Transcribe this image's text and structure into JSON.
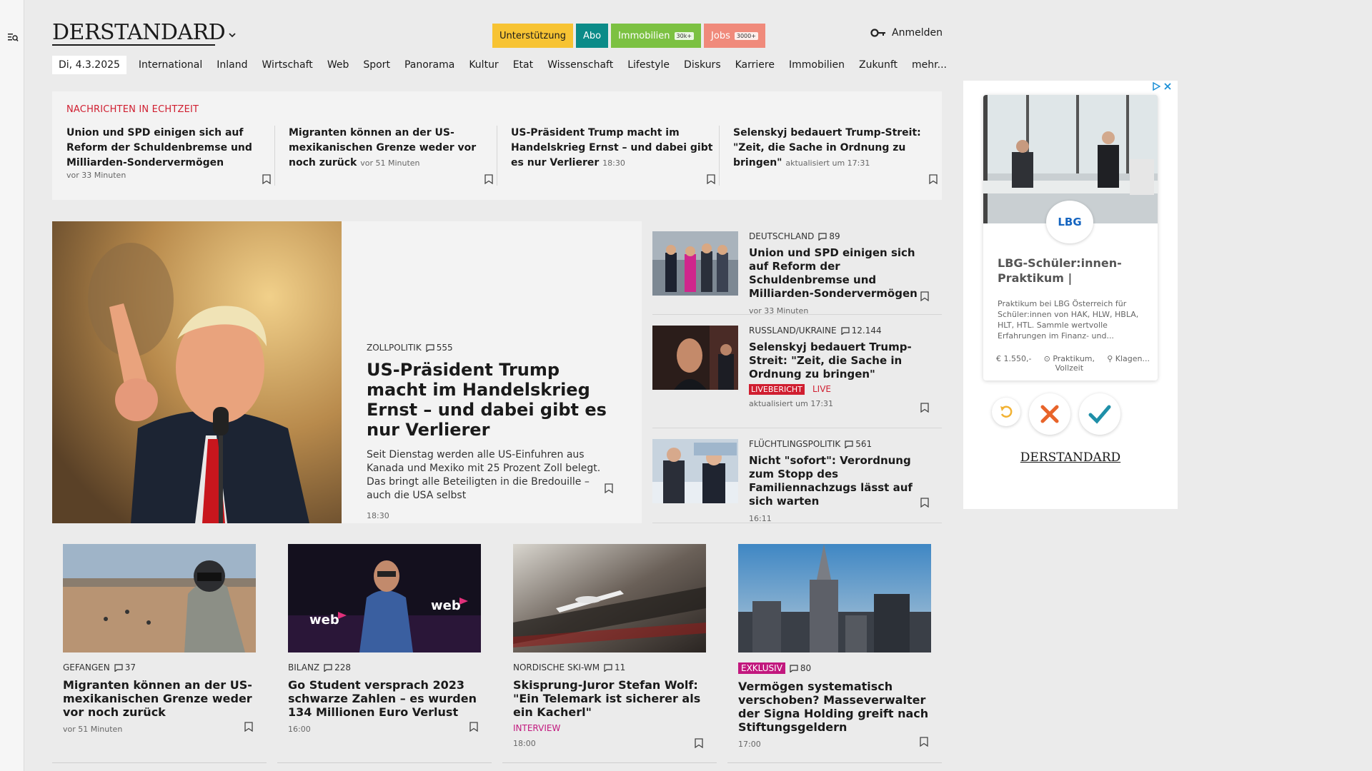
{
  "header": {
    "logo": "DERSTANDARD",
    "pills": [
      {
        "label": "Unterstützung",
        "badge": ""
      },
      {
        "label": "Abo",
        "badge": ""
      },
      {
        "label": "Immobilien",
        "badge": "30k+"
      },
      {
        "label": "Jobs",
        "badge": "3000+"
      }
    ],
    "login": "Anmelden"
  },
  "nav": {
    "date": "Di, 4.3.2025",
    "items": [
      "International",
      "Inland",
      "Wirtschaft",
      "Web",
      "Sport",
      "Panorama",
      "Kultur",
      "Etat",
      "Wissenschaft",
      "Lifestyle",
      "Diskurs",
      "Karriere",
      "Immobilien",
      "Zukunft",
      "mehr..."
    ]
  },
  "live": {
    "heading": "NACHRICHTEN IN ECHTZEIT",
    "items": [
      {
        "title": "Union und SPD einigen sich auf Reform der Schuldenbremse und Milliarden-Sondervermögen",
        "meta": "vor 33 Minuten"
      },
      {
        "title": "Migranten können an der US-mexikanischen Grenze weder vor noch zurück",
        "meta": "vor 51 Minuten"
      },
      {
        "title": "US-Präsident Trump macht im Handelskrieg Ernst – und dabei gibt es nur Verlierer",
        "meta": "18:30"
      },
      {
        "title": "Selenskyj bedauert Trump-Streit: \"Zeit, die Sache in Ordnung zu bringen\"",
        "meta": "aktualisiert um 17:31"
      }
    ]
  },
  "hero": {
    "kicker": "ZOLLPOLITIK",
    "comments": "555",
    "title": "US-Präsident Trump macht im Handelskrieg Ernst – und dabei gibt es nur Verlierer",
    "lead": "Seit Dienstag werden alle US-Einfuhren aus Kanada und Mexiko mit 25 Prozent Zoll belegt. Das bringt alle Beteiligten in die Bredouille – auch die USA selbst",
    "time": "18:30"
  },
  "side": [
    {
      "kicker": "DEUTSCHLAND",
      "comments": "89",
      "title": "Union und SPD einigen sich auf Reform der Schuldenbremse und Milliarden-Sondervermögen",
      "meta": "vor 33 Minuten"
    },
    {
      "kicker": "RUSSLAND/UKRAINE",
      "comments": "12.144",
      "title": "Selenskyj bedauert Trump-Streit: \"Zeit, die Sache in Ordnung zu bringen\"",
      "label": "LIVEBERICHT",
      "label2": "LIVE",
      "meta": "aktualisiert um 17:31"
    },
    {
      "kicker": "FLÜCHTLINGSPOLITIK",
      "comments": "561",
      "title": "Nicht \"sofort\": Verordnung zum Stopp des Familiennachzugs lässt auf sich warten",
      "meta": "16:11"
    }
  ],
  "cards": [
    {
      "kicker": "GEFANGEN",
      "comments": "37",
      "title": "Migranten können an der US-mexikanischen Grenze weder vor noch zurück",
      "meta": "vor 51 Minuten"
    },
    {
      "kicker": "BILANZ",
      "comments": "228",
      "title": "Go Student versprach 2023 schwarze Zahlen – es wurden 134 Millionen Euro Verlust",
      "meta": "16:00"
    },
    {
      "kicker": "NORDISCHE SKI-WM",
      "comments": "11",
      "title": "Skisprung-Juror Stefan Wolf: \"Ein Telemark ist sicherer als ein Kacherl\"",
      "tag": "INTERVIEW",
      "meta": "18:00"
    },
    {
      "badge": "EXKLUSIV",
      "comments": "80",
      "title": "Vermögen systematisch verschoben? Masseverwalter der Signa Holding greift nach Stiftungsgeldern",
      "meta": "17:00"
    }
  ],
  "ad": {
    "logo": "LBG",
    "title": "LBG-Schüler:innen-Praktikum |",
    "description": "Praktikum bei LBG Österreich für Schüler:innen von HAK, HLW, HBLA, HLT, HTL. Sammle wertvolle Erfahrungen im Finanz- und...",
    "salary": "1.550,-",
    "type": "Praktikum, Vollzeit",
    "location": "Klagen...",
    "brand": "DERSTANDARD"
  },
  "colors": {
    "accent_red": "#d01e30",
    "magenta": "#c2187e",
    "support": "#f7c333",
    "abo": "#0b8b88",
    "immobilien": "#7cc142",
    "jobs": "#f08a7b"
  }
}
